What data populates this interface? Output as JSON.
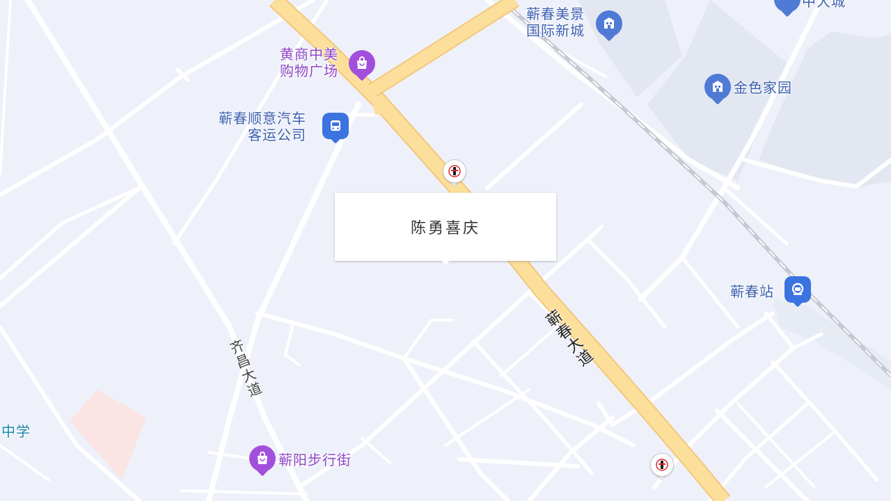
{
  "map": {
    "colors": {
      "background": "#eef1f9",
      "block": "#e2e7f1",
      "road": "#ffffff",
      "main_road": "#fddf9c",
      "railway": "#c6c9d2",
      "school_area": "#fbe4e4"
    },
    "pois": [
      {
        "id": "jinchun-meijing",
        "label_lines": [
          "蕲春美景",
          "国际新城"
        ],
        "icon": "residential-icon",
        "color": "#4f7ad6"
      },
      {
        "id": "top-right-city",
        "label_lines": [
          "中大城"
        ],
        "icon": "residential-icon",
        "color": "#4f7ad6"
      },
      {
        "id": "jinse-jiayuan",
        "label_lines": [
          "金色家园"
        ],
        "icon": "residential-icon",
        "color": "#4f7ad6"
      },
      {
        "id": "huangshang",
        "label_lines": [
          "黄商中美",
          "购物广场"
        ],
        "icon": "shopping-bag-icon",
        "color": "#a24fdc"
      },
      {
        "id": "shunyi-bus",
        "label_lines": [
          "蕲春顺意汽车",
          "客运公司"
        ],
        "icon": "bus-icon",
        "color": "#3b73e0"
      },
      {
        "id": "qichun-station",
        "label_lines": [
          "蕲春站"
        ],
        "icon": "train-station-icon",
        "color": "#3b73e0"
      },
      {
        "id": "qiyang-street",
        "label_lines": [
          "蕲阳步行街"
        ],
        "icon": "shopping-bag-icon",
        "color": "#a24fdc"
      },
      {
        "id": "middle-school",
        "label_lines": [
          "中学"
        ],
        "icon": "",
        "color": "#1a86a8"
      }
    ],
    "roads": {
      "qichun_avenue": "蕲春大道",
      "qichang_avenue": "齐昌大道"
    },
    "gas_stations": [
      {
        "id": "gas-1",
        "icon": "sinopec-icon"
      },
      {
        "id": "gas-2",
        "icon": "sinopec-icon"
      }
    ]
  },
  "popup": {
    "text": "陈勇喜庆"
  }
}
